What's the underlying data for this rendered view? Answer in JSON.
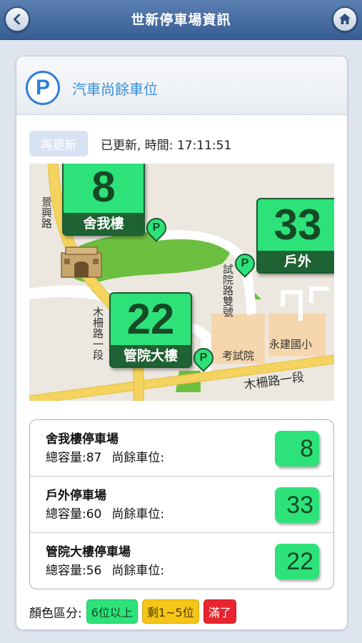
{
  "nav": {
    "title": "世新停車場資訊",
    "back_icon": "chevron-left-icon",
    "home_icon": "home-icon"
  },
  "header": {
    "icon_label": "P",
    "title": "汽車尚餘車位"
  },
  "refresh": {
    "button_label": "再更新",
    "status_text": "已更新, 時間:   17:11:51"
  },
  "map": {
    "badges": [
      {
        "count": "8",
        "label": "舍我樓"
      },
      {
        "count": "33",
        "label": "戶外"
      },
      {
        "count": "22",
        "label": "管院大樓"
      }
    ],
    "pin_label": "P",
    "roads": {
      "jingxing": "景興路",
      "shiyuan": "試院路雙號",
      "muzha_v": "木柵路一段",
      "muzha_h": "木柵路一段",
      "kaoshiyuan": "考試院",
      "yongjian": "永建國小"
    }
  },
  "lots": [
    {
      "name": "舍我樓停車場",
      "capacity_label": "總容量:87",
      "remaining_label": "尚餘車位:",
      "count": "8"
    },
    {
      "name": "戶外停車場",
      "capacity_label": "總容量:60",
      "remaining_label": "尚餘車位:",
      "count": "33"
    },
    {
      "name": "管院大樓停車場",
      "capacity_label": "總容量:56",
      "remaining_label": "尚餘車位:",
      "count": "22"
    }
  ],
  "legend": {
    "label": "顏色區分:",
    "items": [
      {
        "text": "6位以上",
        "color": "#2ee27a"
      },
      {
        "text": "剩1~5位",
        "color": "#f5c518"
      },
      {
        "text": "滿了",
        "color": "#e8242e"
      }
    ]
  },
  "colors": {
    "nav_bar": "#375d93",
    "available": "#2ee27a",
    "accent": "#3a8fd6"
  }
}
